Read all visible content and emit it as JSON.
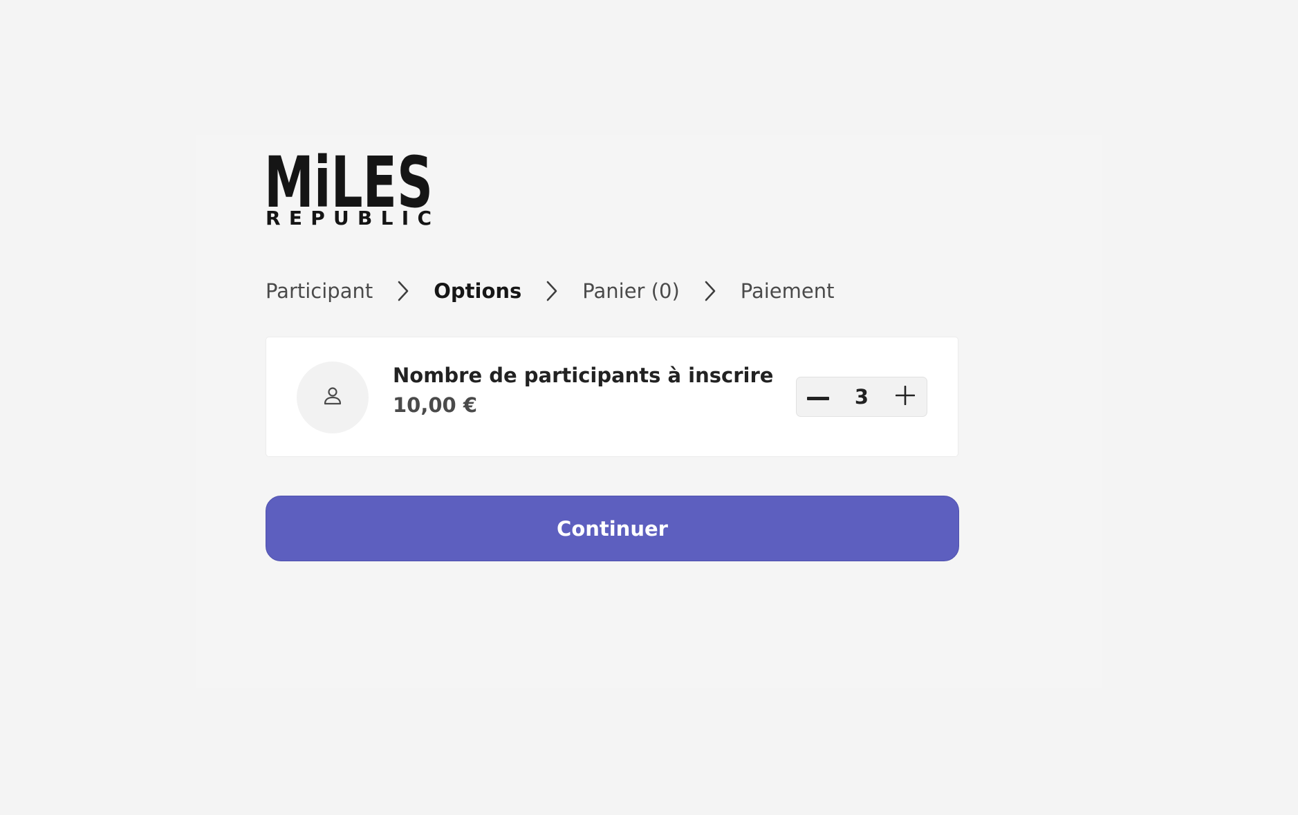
{
  "brand": {
    "logo_line1": "MiLES",
    "logo_line2": "REPUBLIC"
  },
  "steps": [
    {
      "label": "Participant",
      "active": false
    },
    {
      "label": "Options",
      "active": true
    },
    {
      "label": "Panier (0)",
      "active": false
    },
    {
      "label": "Paiement",
      "active": false
    }
  ],
  "option": {
    "icon": "user-icon",
    "title": "Nombre de participants à inscrire",
    "price": "10,00 €",
    "quantity": "3"
  },
  "actions": {
    "continue_label": "Continuer"
  },
  "colors": {
    "primary": "#5d5fbf",
    "active_underline": "#f8c9de",
    "background": "#f4f4f4",
    "card": "#ffffff"
  }
}
